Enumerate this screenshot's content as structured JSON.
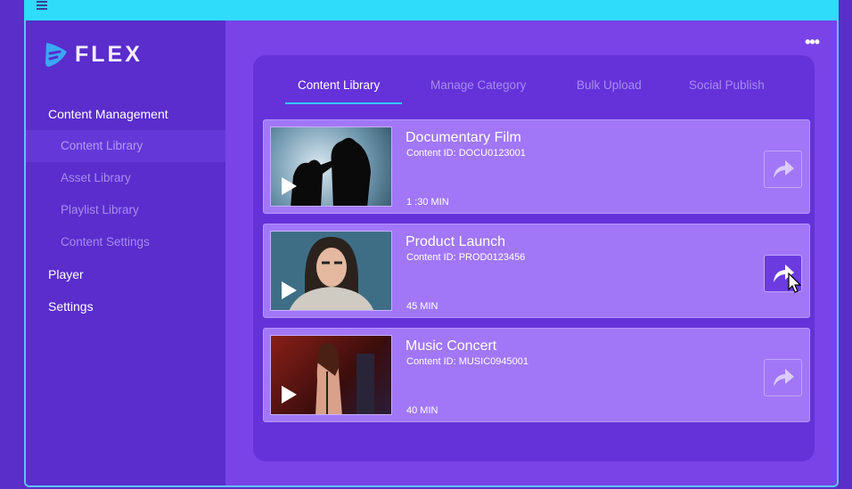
{
  "app": {
    "name": "FLEX"
  },
  "sidebar": {
    "items": [
      {
        "label": "Content Management",
        "level": "section"
      },
      {
        "label": "Content Library",
        "level": "sub",
        "active": true
      },
      {
        "label": "Asset Library",
        "level": "sub"
      },
      {
        "label": "Playlist Library",
        "level": "sub"
      },
      {
        "label": "Content Settings",
        "level": "sub"
      },
      {
        "label": "Player",
        "level": "section"
      },
      {
        "label": "Settings",
        "level": "section"
      }
    ]
  },
  "tabs": [
    {
      "label": "Content Library",
      "active": true
    },
    {
      "label": "Manage Category"
    },
    {
      "label": "Bulk Upload"
    },
    {
      "label": "Social Publish"
    }
  ],
  "content": [
    {
      "title": "Documentary Film",
      "content_id": "Content ID: DOCU0123001",
      "duration": "1 :30 MIN"
    },
    {
      "title": "Product Launch",
      "content_id": "Content ID: PROD0123456",
      "duration": "45 MIN"
    },
    {
      "title": "Music Concert",
      "content_id": "Content ID: MUSIC0945001",
      "duration": "40 MIN"
    }
  ],
  "colors": {
    "topbar": "#2fdcfa",
    "sidebar": "#5a2dcc",
    "main": "#7943e8",
    "card": "#a177f7",
    "accent": "#35c7f5"
  }
}
